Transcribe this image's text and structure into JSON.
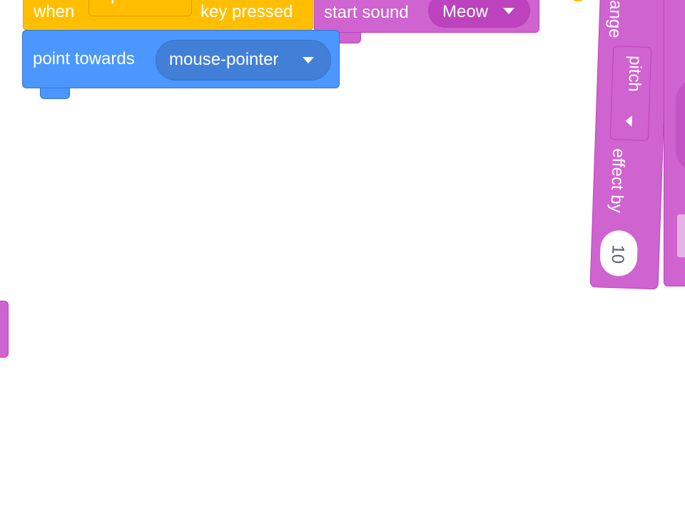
{
  "blocks": {
    "when_key": {
      "prefix": "when",
      "key": "space",
      "suffix": "key pressed"
    },
    "start_sound": {
      "label": "start sound",
      "sound": "Meow"
    },
    "point_towards": {
      "label": "point towards",
      "target": "mouse-pointer"
    },
    "change_effect": {
      "label_start": "ange",
      "effect": "pitch",
      "label_mid": "effect by",
      "value": "10"
    }
  },
  "colors": {
    "events": "#ffbf00",
    "sound": "#cf63cf",
    "motion": "#4c97ff",
    "canvas": "#ffffff"
  }
}
